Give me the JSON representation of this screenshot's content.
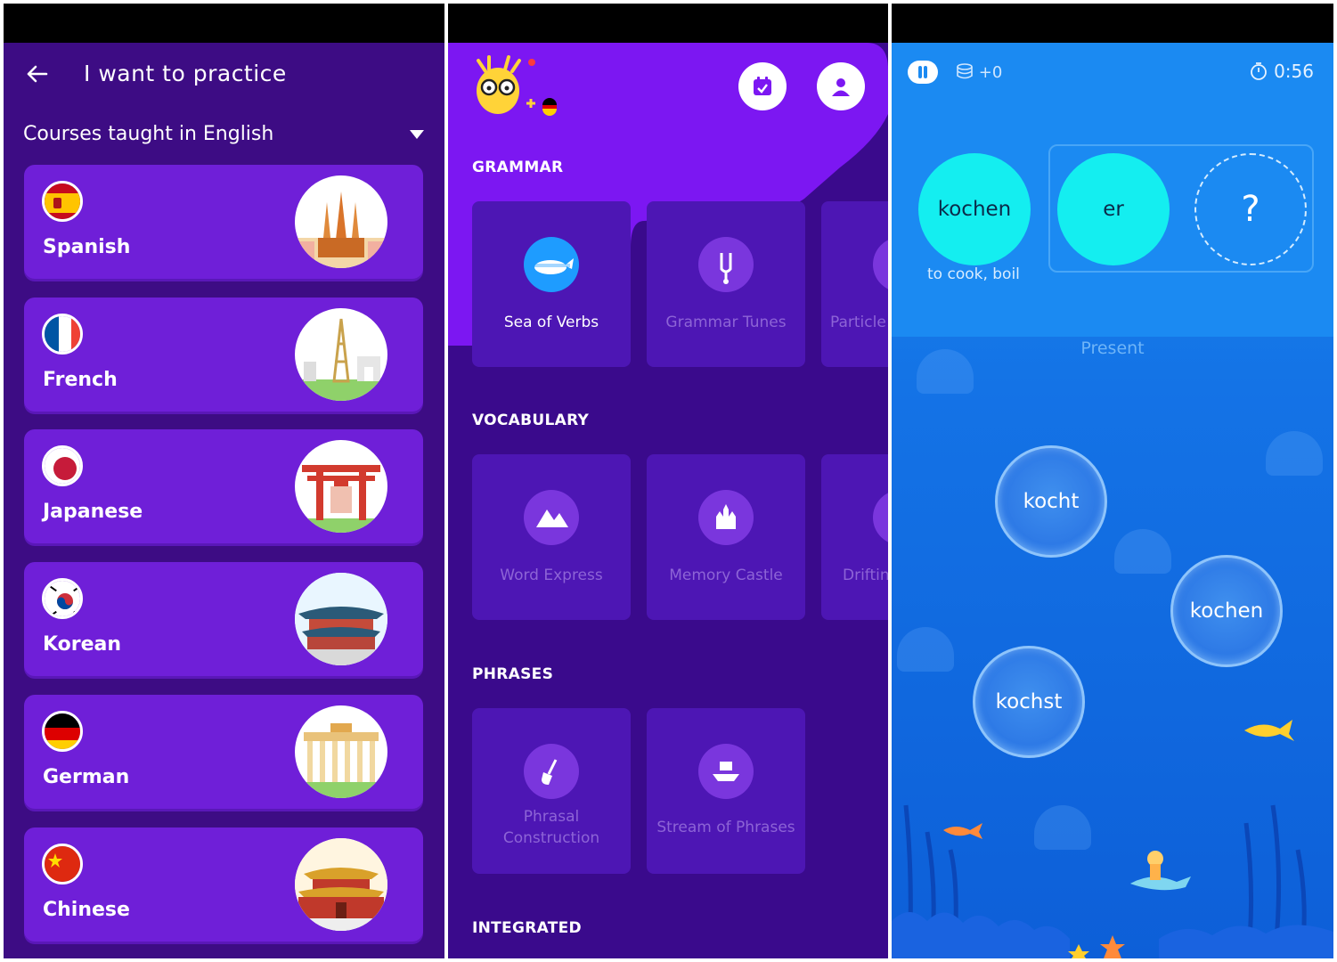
{
  "left": {
    "title": "I want to practice",
    "subtitle": "Courses taught in English",
    "courses": [
      {
        "name": "Spanish"
      },
      {
        "name": "French"
      },
      {
        "name": "Japanese"
      },
      {
        "name": "Korean"
      },
      {
        "name": "German"
      },
      {
        "name": "Chinese"
      }
    ]
  },
  "middle": {
    "sections": {
      "grammar": "GRAMMAR",
      "vocabulary": "VOCABULARY",
      "phrases": "PHRASES",
      "integrated": "INTEGRATED"
    },
    "grammar_tiles": [
      "Sea of Verbs",
      "Grammar Tunes",
      "Particle"
    ],
    "vocabulary_tiles": [
      "Word Express",
      "Memory Castle",
      "Driftin"
    ],
    "phrases_tiles": [
      "Phrasal\nConstruction",
      "Stream of Phrases"
    ]
  },
  "right": {
    "coins": "+0",
    "timer": "0:56",
    "verb": "kochen",
    "pronoun": "er",
    "blank": "?",
    "gloss": "to cook, boil",
    "tense": "Present",
    "options": [
      "kocht",
      "kochen",
      "kochst"
    ]
  },
  "colors": {
    "panel1_bg": "#3d0c84",
    "card_bg": "#6f1fd8",
    "panel2_bg": "#3a0a8c",
    "accent_purple": "#8a2cf2",
    "cyan_bubble": "#14eef0",
    "ocean_blue": "#1473e6"
  }
}
